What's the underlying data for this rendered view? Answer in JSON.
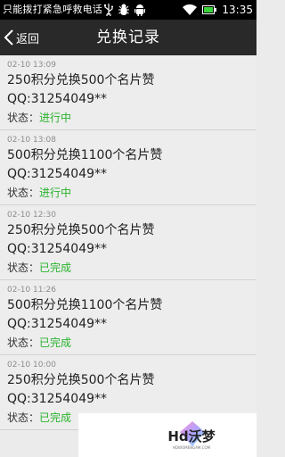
{
  "status_bar": {
    "carrier_text": "只能拨打紧急呼救电话",
    "time": "13:35",
    "icons": [
      "usb-icon",
      "debug-icon",
      "android-icon",
      "wifi-icon",
      "battery-icon"
    ]
  },
  "header": {
    "back_label": "返回",
    "title": "兑换记录"
  },
  "status_label": "状态：",
  "records": [
    {
      "time": "02-10 13:09",
      "desc": "250积分兑换500个名片赞",
      "qq": "QQ:31254049**",
      "status": "进行中"
    },
    {
      "time": "02-10 13:08",
      "desc": "500积分兑换1100个名片赞",
      "qq": "QQ:31254049**",
      "status": "进行中"
    },
    {
      "time": "02-10 12:30",
      "desc": "250积分兑换500个名片赞",
      "qq": "QQ:31254049**",
      "status": "已完成"
    },
    {
      "time": "02-10 11:26",
      "desc": "500积分兑换1100个名片赞",
      "qq": "QQ:31254049**",
      "status": "已完成"
    },
    {
      "time": "02-10 10:00",
      "desc": "250积分兑换500个名片赞",
      "qq": "QQ:31254049**",
      "status": "已完成"
    }
  ],
  "watermark": {
    "logo_text": "Hd沃梦",
    "url_text": "HDWOMENGAM.COM"
  },
  "colors": {
    "status_green": "#27b32b",
    "header_bg": "#292929",
    "list_bg": "#ededed"
  }
}
